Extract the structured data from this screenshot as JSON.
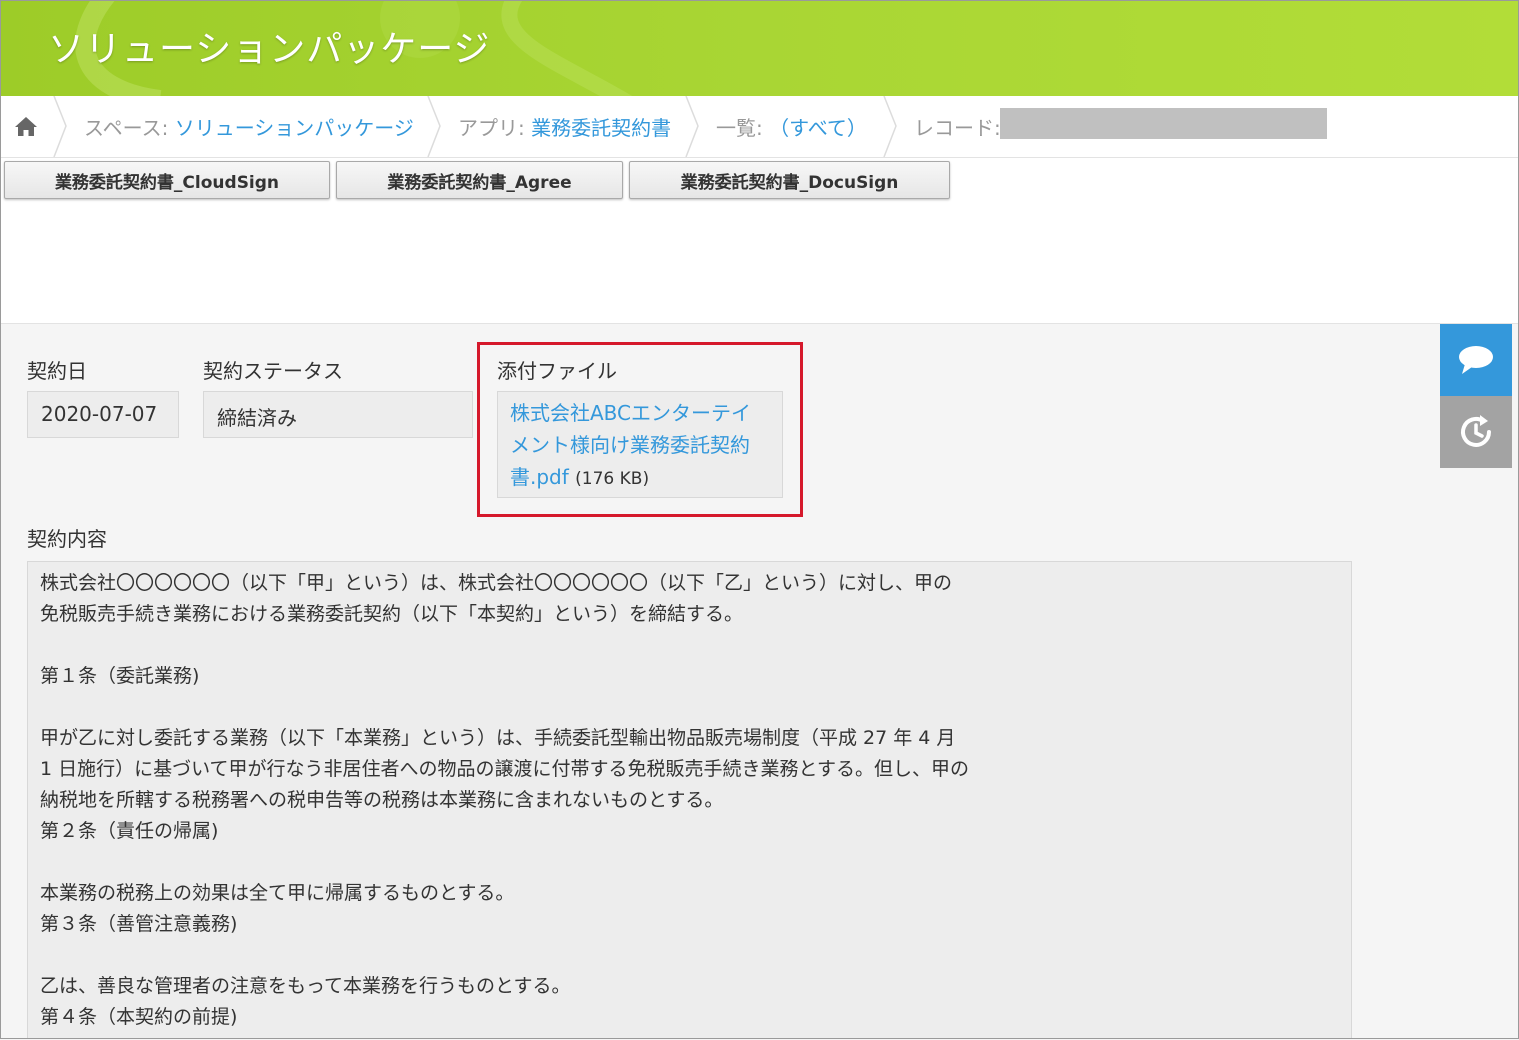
{
  "header": {
    "title": "ソリューションパッケージ"
  },
  "breadcrumb": {
    "space_label": "スペース:",
    "space_value": "ソリューションパッケージ",
    "app_label": "アプリ:",
    "app_value": "業務委託契約書",
    "view_label": "一覧:",
    "view_value": "（すべて）",
    "record_label": "レコード:"
  },
  "buttons": [
    {
      "label": "業務委託契約書_CloudSign"
    },
    {
      "label": "業務委託契約書_Agree"
    },
    {
      "label": "業務委託契約書_DocuSign"
    }
  ],
  "fields": {
    "contract_date": {
      "label": "契約日",
      "value": "2020-07-07"
    },
    "contract_status": {
      "label": "契約ステータス",
      "value": "締結済み"
    },
    "attachment": {
      "label": "添付ファイル",
      "lines": [
        "株式会社ABCエンターテイ",
        "メント様向け業務委託契約",
        "書.pdf"
      ],
      "size": "(176 KB)"
    },
    "contract_body": {
      "label": "契約内容",
      "lines": [
        "株式会社〇〇〇〇〇〇（以下「甲」という）は、株式会社〇〇〇〇〇〇（以下「乙」という）に対し、甲の",
        "免税販売手続き業務における業務委託契約（以下「本契約」という）を締結する。",
        "",
        "第１条（委託業務)",
        "",
        "甲が乙に対し委託する業務（以下「本業務」という）は、手続委託型輸出物品販売場制度（平成 27 年 4 月",
        "1 日施行）に基づいて甲が行なう非居住者への物品の譲渡に付帯する免税販売手続き業務とする。但し、甲の",
        "納税地を所轄する税務署への税申告等の税務は本業務に含まれないものとする。",
        "第２条（責任の帰属)",
        "",
        "本業務の税務上の効果は全て甲に帰属するものとする。",
        "第３条（善管注意義務)",
        "",
        "乙は、善良な管理者の注意をもって本業務を行うものとする。",
        "第４条（本契約の前提)"
      ]
    }
  },
  "side": {
    "comment_icon": "comment-icon",
    "history_icon": "history-icon"
  }
}
